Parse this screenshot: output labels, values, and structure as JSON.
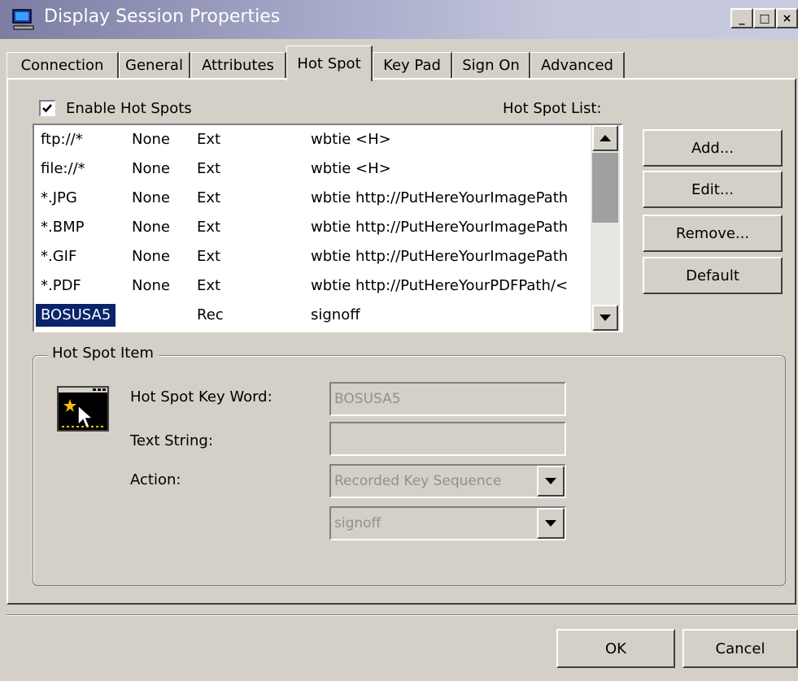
{
  "window": {
    "title": "Display Session Properties",
    "caption_buttons": {
      "minimize": "_",
      "maximize": "□",
      "close": "×"
    }
  },
  "tabs": [
    {
      "label": "Connection",
      "active": false
    },
    {
      "label": "General",
      "active": false
    },
    {
      "label": "Attributes",
      "active": false
    },
    {
      "label": "Hot Spot",
      "active": true
    },
    {
      "label": "Key Pad",
      "active": false
    },
    {
      "label": "Sign On",
      "active": false
    },
    {
      "label": "Advanced",
      "active": false
    }
  ],
  "hotspot": {
    "enable_label": "Enable Hot Spots",
    "enable_checked": true,
    "list_label": "Hot Spot List:",
    "list": [
      {
        "keyword": "ftp://*",
        "mode": "None",
        "type": "Ext",
        "command": "wbtie <H>"
      },
      {
        "keyword": "file://*",
        "mode": "None",
        "type": "Ext",
        "command": "wbtie <H>"
      },
      {
        "keyword": "*.JPG",
        "mode": "None",
        "type": "Ext",
        "command": "wbtie http://PutHereYourImagePath"
      },
      {
        "keyword": "*.BMP",
        "mode": "None",
        "type": "Ext",
        "command": "wbtie http://PutHereYourImagePath"
      },
      {
        "keyword": "*.GIF",
        "mode": "None",
        "type": "Ext",
        "command": "wbtie http://PutHereYourImagePath"
      },
      {
        "keyword": "*.PDF",
        "mode": "None",
        "type": "Ext",
        "command": "wbtie http://PutHereYourPDFPath/<"
      },
      {
        "keyword": "BOSUSA5",
        "mode": "",
        "type": "Rec",
        "command": "signoff",
        "selected": true
      }
    ],
    "buttons": {
      "add": "Add...",
      "edit": "Edit...",
      "remove": "Remove...",
      "default": "Default"
    },
    "item": {
      "group_title": "Hot Spot Item",
      "keyword_label": "Hot Spot Key Word:",
      "keyword_value": "BOSUSA5",
      "text_label": "Text String:",
      "text_value": "",
      "action_label": "Action:",
      "action_value": "Recorded Key Sequence",
      "sequence_value": "signoff"
    }
  },
  "footer": {
    "ok": "OK",
    "cancel": "Cancel"
  },
  "colors": {
    "face": "#d4d0c8",
    "selection": "#0a246a",
    "disabled_text": "#909090"
  },
  "icons": {
    "title": "display-session-icon",
    "hotspot": "hotspot-cursor-icon",
    "scroll_up": "arrow-up-icon",
    "scroll_down": "arrow-down-icon",
    "dropdown": "chevron-down-icon"
  }
}
